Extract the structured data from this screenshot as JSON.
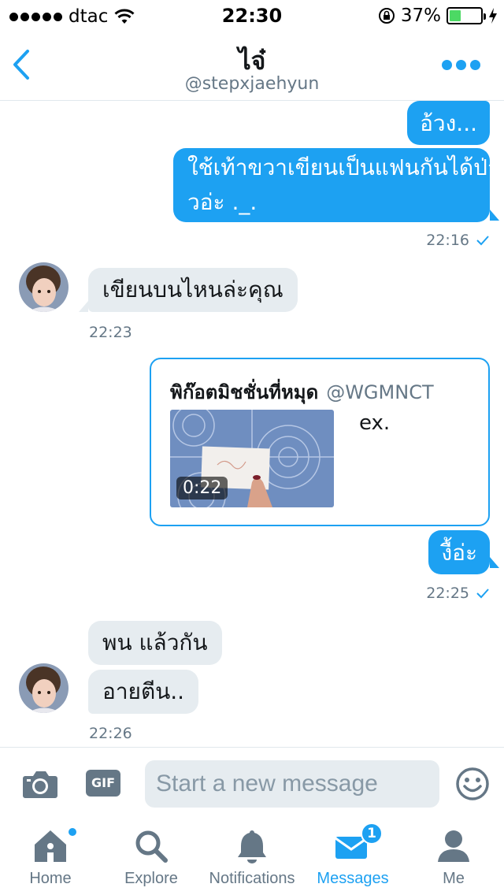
{
  "status_bar": {
    "carrier": "dtac",
    "time": "22:30",
    "battery_percent": "37%",
    "battery_level": 0.37,
    "signal_bars": 5
  },
  "header": {
    "title": "ไจ๋",
    "handle": "@stepxjaehyun",
    "accent": "#1da1f2"
  },
  "messages": [
    {
      "direction": "out",
      "text": "อ้วง..."
    },
    {
      "direction": "out",
      "text_line1": "ใช้เท้าขวาเขียนเป็นแฟนกันได้ป่า",
      "text_line2": "วอ่ะ ._.",
      "time": "22:16",
      "read": true
    },
    {
      "direction": "in",
      "text": "เขียนบนไหนล่ะคุณ",
      "time": "22:23"
    },
    {
      "direction": "out",
      "type": "tweet_card",
      "card": {
        "author": "พิก๊อตมิชชั่นที่หมุด",
        "handle": "@WGMNCT",
        "text": "ex.",
        "video_duration": "0:22"
      }
    },
    {
      "direction": "out",
      "text": "งื้อ่ะ",
      "time": "22:25",
      "read": true
    },
    {
      "direction": "in",
      "text": "พน แล้วกัน"
    },
    {
      "direction": "in",
      "text": "อายตีน..",
      "time": "22:26"
    }
  ],
  "composer": {
    "placeholder": "Start a new message",
    "gif_label": "GIF"
  },
  "tabs": [
    {
      "label": "Home",
      "icon": "home-icon",
      "badge_dot": true
    },
    {
      "label": "Explore",
      "icon": "search-icon"
    },
    {
      "label": "Notifications",
      "icon": "bell-icon"
    },
    {
      "label": "Messages",
      "icon": "mail-icon",
      "active": true,
      "badge_count": "1"
    },
    {
      "label": "Me",
      "icon": "person-icon"
    }
  ],
  "colors": {
    "bubble_out": "#1da1f2",
    "bubble_in": "#e6ecf0",
    "muted_text": "#657786",
    "battery_fill": "#4cd964"
  }
}
